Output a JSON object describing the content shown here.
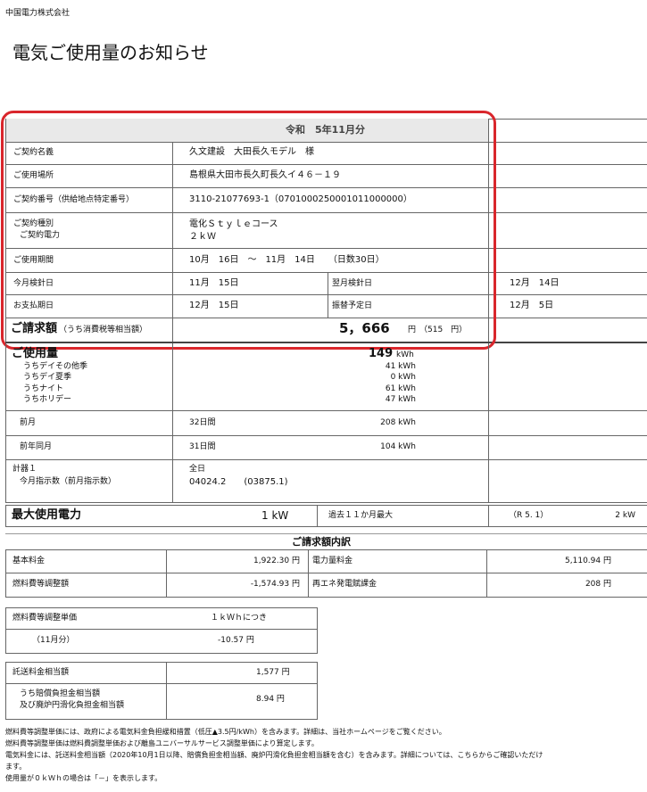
{
  "company": "中国電力株式会社",
  "title": "電気ご使用量のお知らせ",
  "period_header": "令和　5年11月分",
  "contract": {
    "name_label": "ご契約名義",
    "name": "久文建設　大田長久モデル　様",
    "place_label": "ご使用場所",
    "place": "島根県大田市長久町長久イ４６－１９",
    "number_label": "ご契約番号（供給地点特定番号）",
    "number": "3110-21077693-1（0701000250001011000000）",
    "type_label": "ご契約種別",
    "power_label": "ご契約電力",
    "type": "電化Ｓｔｙｌｅコース",
    "power": "２ｋＷ",
    "usage_period_label": "ご使用期間",
    "usage_period": "10月　16日　～　11月　14日　　（日数30日）",
    "meter_date_label": "今月検針日",
    "meter_date": "11月　15日",
    "next_meter_label": "翌月検針日",
    "next_meter": "12月　14日",
    "payment_label": "お支払期日",
    "payment": "12月　15日",
    "transfer_label": "振替予定日",
    "transfer": "12月　5日"
  },
  "billing": {
    "label": "ご請求額",
    "label_sub": "（うち消費税等相当額）",
    "amount": "5，666",
    "unit": "円",
    "tax": "（515　円）"
  },
  "usage": {
    "label": "ご使用量",
    "total": "149",
    "unit": "kWh",
    "breakdown": [
      {
        "label": "うちデイその他季",
        "value": "41 kWh"
      },
      {
        "label": "うちデイ夏季",
        "value": "0 kWh"
      },
      {
        "label": "うちナイト",
        "value": "61 kWh"
      },
      {
        "label": "うちホリデー",
        "value": "47 kWh"
      }
    ],
    "prev_month_label": "前月",
    "prev_month_days": "32日間",
    "prev_month_value": "208 kWh",
    "prev_year_label": "前年同月",
    "prev_year_days": "31日間",
    "prev_year_value": "104 kWh",
    "meter_label": "計器１",
    "reading_label": "今月指示数（前月指示数）",
    "time_label": "全日",
    "reading": "04024.2　　(03875.1)"
  },
  "max_power": {
    "label": "最大使用電力",
    "value": "1 kW",
    "past_label": "過去１１か月最大",
    "past_period": "（R 5. 1）",
    "past_value": "2 kW"
  },
  "breakdown_title": "ご請求額内訳",
  "charges": {
    "basic_label": "基本料金",
    "basic": "1,922.30 円",
    "energy_label": "電力量料金",
    "energy": "5,110.94 円",
    "fuel_label": "燃料費等調整額",
    "fuel": "-1,574.93 円",
    "renew_label": "再エネ発電賦課金",
    "renew": "208 円"
  },
  "fuel_unit": {
    "label": "燃料費等調整単価",
    "per": "１ｋＷｈにつき",
    "month": "（11月分）",
    "value": "-10.57 円"
  },
  "transmission": {
    "label": "託送料金相当額",
    "value": "1,577 円",
    "sub_label_1": "うち賠償負担金相当額",
    "sub_label_2": "及び廃炉円滑化負担金相当額",
    "sub_value": "8.94 円"
  },
  "notes": [
    "燃料費等調整単価には、政府による電気料金負担緩和措置（低圧▲3.5円/kWh）を含みます。詳細は、当社ホームページをご覧ください。",
    "燃料費等調整単価は燃料費調整単価および離島ユニバーサルサービス調整単価により算定します。",
    "電気料金には、託送料金相当額（2020年10月1日以降、賠償負担金相当額、廃炉円滑化負担金相当額を含む）を含みます。詳細については、こちらからご確認いただけ",
    "ます。",
    "使用量が０ｋＷｈの場合は「－」を表示します。"
  ],
  "highlight_color": "#d9262c"
}
